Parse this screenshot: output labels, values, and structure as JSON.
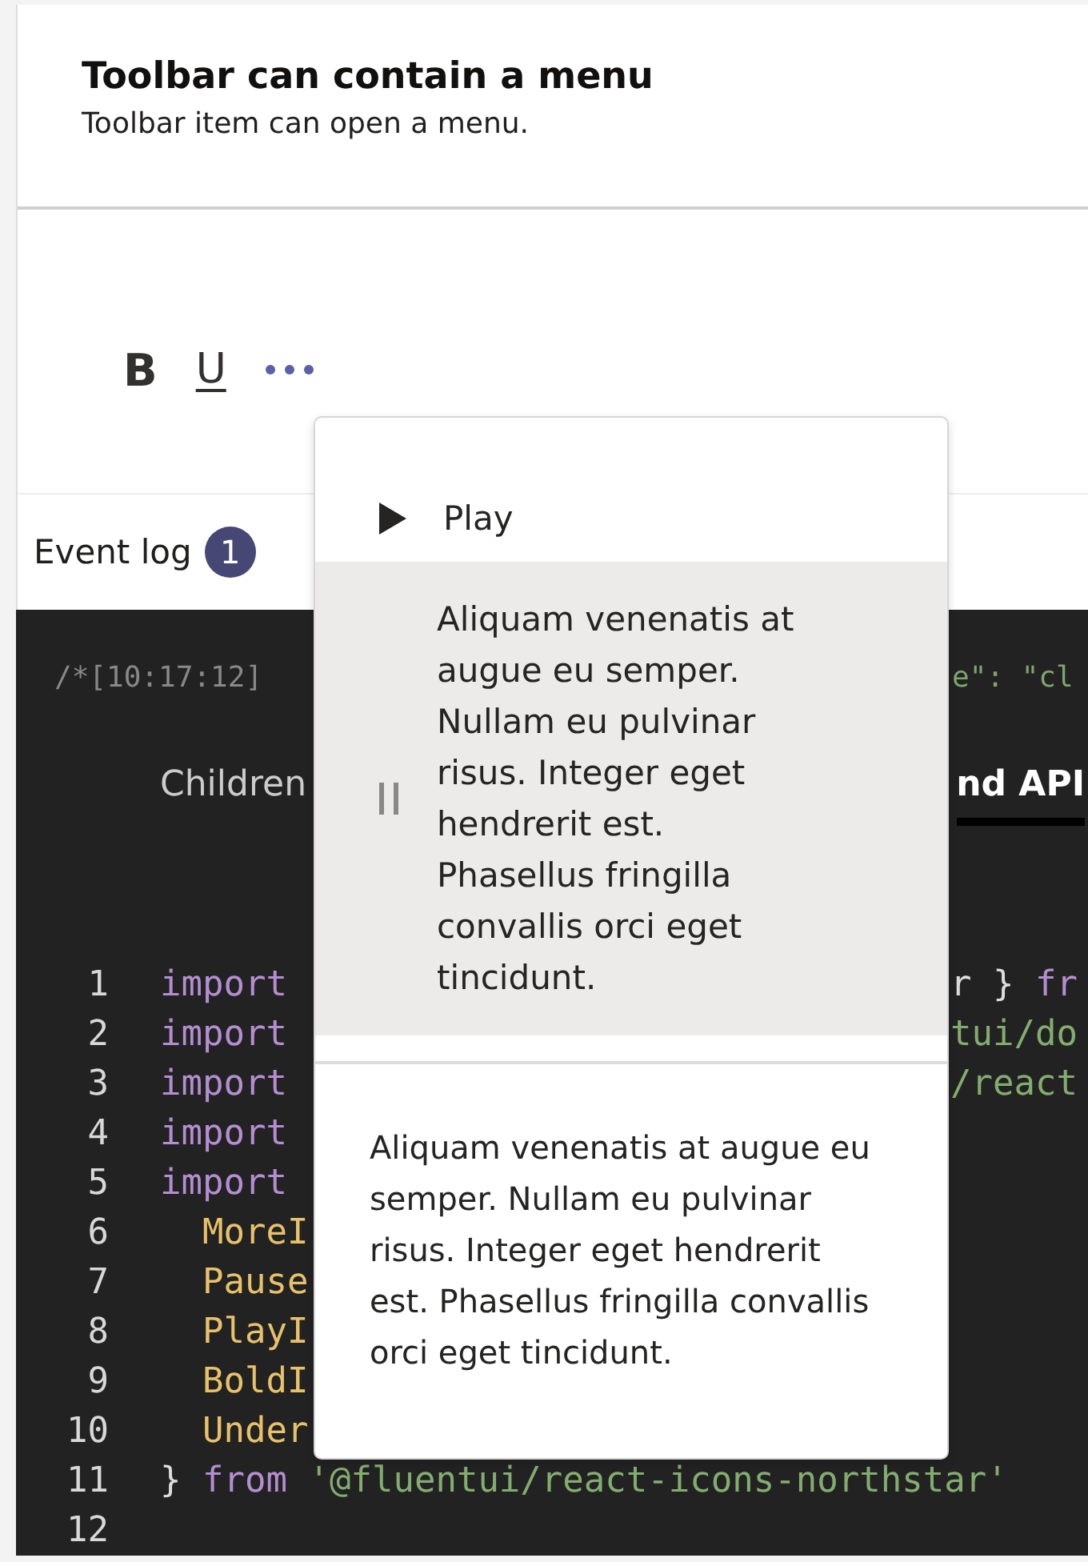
{
  "header": {
    "title": "Toolbar can contain a menu",
    "subtitle": "Toolbar item can open a menu."
  },
  "toolbar": [
    {
      "kind": "bold",
      "label": "B"
    },
    {
      "kind": "underline",
      "label": "U"
    },
    {
      "kind": "more"
    }
  ],
  "event_log": {
    "label": "Event log",
    "badge": "1",
    "entry_left": "/*[10:17:12]",
    "entry_right": "e\": \"cl"
  },
  "code_tabs": [
    {
      "label": "Children",
      "selected": false
    },
    {
      "label": "nd API",
      "selected": true
    }
  ],
  "code_lines": [
    {
      "number": "1",
      "left": [
        {
          "kind": "keyword",
          "text": "import"
        }
      ],
      "right": [
        {
          "kind": "plain",
          "text": "r } "
        },
        {
          "kind": "keyword",
          "text": "fr"
        }
      ]
    },
    {
      "number": "2",
      "left": [
        {
          "kind": "keyword",
          "text": "import"
        }
      ],
      "right": [
        {
          "kind": "string",
          "text": "tui/do"
        }
      ]
    },
    {
      "number": "3",
      "left": [
        {
          "kind": "keyword",
          "text": "import"
        }
      ],
      "right": [
        {
          "kind": "string",
          "text": "/react"
        }
      ]
    },
    {
      "number": "4",
      "left": [
        {
          "kind": "keyword",
          "text": "import"
        }
      ]
    },
    {
      "number": "5",
      "left": [
        {
          "kind": "keyword",
          "text": "import"
        }
      ]
    },
    {
      "number": "6",
      "left": [
        {
          "kind": "ident",
          "text": "  MoreI"
        }
      ]
    },
    {
      "number": "7",
      "left": [
        {
          "kind": "ident",
          "text": "  Pause"
        }
      ]
    },
    {
      "number": "8",
      "left": [
        {
          "kind": "ident",
          "text": "  PlayI"
        }
      ]
    },
    {
      "number": "9",
      "left": [
        {
          "kind": "ident",
          "text": "  BoldI"
        }
      ]
    },
    {
      "number": "10",
      "left": [
        {
          "kind": "ident",
          "text": "  Under"
        }
      ]
    },
    {
      "number": "11",
      "left": [
        {
          "kind": "plain",
          "text": "} "
        },
        {
          "kind": "keyword",
          "text": "from"
        },
        {
          "kind": "string",
          "text": " '@fluentui/react-icons-northstar'"
        }
      ]
    },
    {
      "number": "12"
    }
  ],
  "menu": {
    "items": [
      {
        "kind": "play",
        "label": "Play",
        "selected": false
      },
      {
        "kind": "pause",
        "label": "Aliquam venenatis at augue eu semper. Nullam eu pulvinar risus. Integer eget hendrerit est. Phasellus fringilla convallis orci eget tincidunt.",
        "selected": true
      }
    ],
    "content": "Aliquam venenatis at augue eu semper. Nullam eu pulvinar risus. Integer eget hendrerit est. Phasellus fringilla convallis orci eget tincidunt."
  }
}
